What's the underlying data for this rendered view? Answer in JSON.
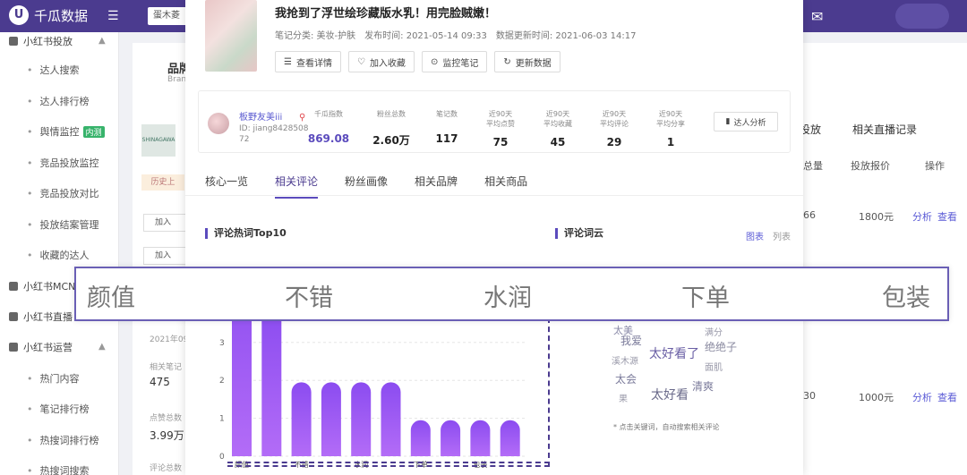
{
  "topbar": {
    "logo_mark": "U",
    "logo_text": "千瓜数据",
    "menu_icon": "menu-fold-icon",
    "search_text": "蛋木菱",
    "mail_icon": "mail-icon"
  },
  "sidebar": {
    "groups": [
      {
        "label": "小红书投放",
        "icon": "gift-icon"
      },
      {
        "label": "小红书MCN",
        "icon": "grid-icon"
      },
      {
        "label": "小红书直播",
        "icon": "video-icon"
      },
      {
        "label": "小红书运营",
        "icon": "chart-icon"
      }
    ],
    "items": [
      {
        "label": "达人搜索"
      },
      {
        "label": "达人排行榜"
      },
      {
        "label": "舆情监控",
        "badge": "内测"
      },
      {
        "label": "竞品投放监控"
      },
      {
        "label": "竞品投放对比"
      },
      {
        "label": "投放结案管理"
      },
      {
        "label": "收藏的达人"
      },
      {
        "label": "热门内容"
      },
      {
        "label": "笔记排行榜"
      },
      {
        "label": "热搜词排行榜"
      },
      {
        "label": "热搜词搜索"
      }
    ]
  },
  "background": {
    "brand_title": "品牌",
    "brand_sub": "Bran",
    "brand_logo_text": "SHINAGAWA",
    "history_chip": "历史上",
    "btn_add": "加入",
    "btn_add2": "加入",
    "tab_delivery": "投放",
    "tab_live": "相关直播记录",
    "col_total": "总量",
    "col_price": "投放报价",
    "col_op": "操作",
    "row1_num": "66",
    "row1_price": "1800元",
    "row2_num": "30",
    "row2_price": "1000元",
    "analyze": "分析",
    "view": "查看",
    "date_frag": "2021年09",
    "label_notes": "相关笔记",
    "val_notes": "475",
    "label_fans": "点赞总数",
    "val_fans": "3.99万",
    "label_comments": "评论总数"
  },
  "note": {
    "title": "我抢到了浮世绘珍藏版水乳！用完脸贼嫩！",
    "category": "笔记分类: 美妆-护肤",
    "publish_time": "发布时间: 2021-05-14 09:33",
    "update_time": "数据更新时间: 2021-06-03 14:17",
    "actions": [
      {
        "label": "查看详情",
        "icon": "list-icon"
      },
      {
        "label": "加入收藏",
        "icon": "heart-icon"
      },
      {
        "label": "监控笔记",
        "icon": "location-icon"
      },
      {
        "label": "更新数据",
        "icon": "refresh-icon"
      }
    ]
  },
  "kol": {
    "name": "板野友美iii",
    "id": "ID: jiang842850872",
    "analysis_button": "达人分析",
    "stats": [
      {
        "label": "千瓜指数",
        "value": "869.08",
        "accent": true
      },
      {
        "label": "粉丝总数",
        "value": "2.60万"
      },
      {
        "label": "笔记数",
        "value": "117"
      },
      {
        "label": "近90天\n平均点赞",
        "value": "75"
      },
      {
        "label": "近90天\n平均收藏",
        "value": "45"
      },
      {
        "label": "近90天\n平均评论",
        "value": "29"
      },
      {
        "label": "近90天\n平均分享",
        "value": "1"
      }
    ]
  },
  "tabs": [
    {
      "label": "核心一览",
      "active": false
    },
    {
      "label": "相关评论",
      "active": true
    },
    {
      "label": "粉丝画像",
      "active": false
    },
    {
      "label": "相关品牌",
      "active": false
    },
    {
      "label": "相关商品",
      "active": false
    }
  ],
  "sections": {
    "hotwords_title": "评论热词Top10",
    "cloud_title": "评论词云",
    "toggle_chart": "图表",
    "toggle_list": "列表",
    "cloud_tip": "* 点击关键词，自动搜索相关评论"
  },
  "chart_data": {
    "type": "bar",
    "title": "评论热词Top10",
    "categories": [
      "颜值",
      "",
      "不错",
      "",
      "水润",
      "",
      "下单",
      "",
      "包装",
      ""
    ],
    "values": [
      5,
      3.9,
      1.95,
      1.95,
      1.95,
      1.95,
      0.95,
      0.95,
      0.95,
      0.95
    ],
    "yticks": [
      0,
      1,
      2,
      3,
      4
    ],
    "ylim": [
      0,
      5
    ],
    "color_top": "#8b4cf0",
    "color_bottom": "#b36cf7"
  },
  "word_cloud": [
    {
      "text": "太美",
      "size": 11
    },
    {
      "text": "满分",
      "size": 10
    },
    {
      "text": "我爱",
      "size": 12
    },
    {
      "text": "绝绝子",
      "size": 12
    },
    {
      "text": "太好看了",
      "size": 14
    },
    {
      "text": "溪木源",
      "size": 10
    },
    {
      "text": "面肌",
      "size": 10
    },
    {
      "text": "太会",
      "size": 12
    },
    {
      "text": "清爽",
      "size": 12
    },
    {
      "text": "太好看",
      "size": 14
    },
    {
      "text": "果",
      "size": 10
    }
  ],
  "banner": {
    "words": [
      "颜值",
      "不错",
      "水润",
      "下单",
      "包装"
    ]
  },
  "colors": {
    "brand": "#4b3b8f",
    "accent": "#5b4bbd",
    "link": "#5b5bd6",
    "badge_green": "#37b36b"
  }
}
